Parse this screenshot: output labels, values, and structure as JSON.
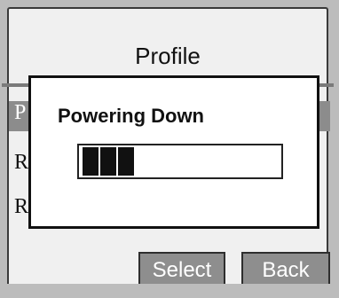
{
  "screen": {
    "title": "Profile",
    "list_items": [
      "P",
      "R",
      "R"
    ]
  },
  "softkeys": {
    "select_label": "Select",
    "back_label": "Back"
  },
  "dialog": {
    "title": "Powering Down",
    "progress": {
      "filled_segments": 3,
      "fraction": 0.25
    }
  },
  "colors": {
    "background": "#bcbcbc",
    "screen_bg": "#f0f0f0",
    "highlight": "#8c8c8c",
    "softkey_bg": "#8e8e8e",
    "dialog_border": "#111111",
    "progress_fill": "#111111"
  }
}
